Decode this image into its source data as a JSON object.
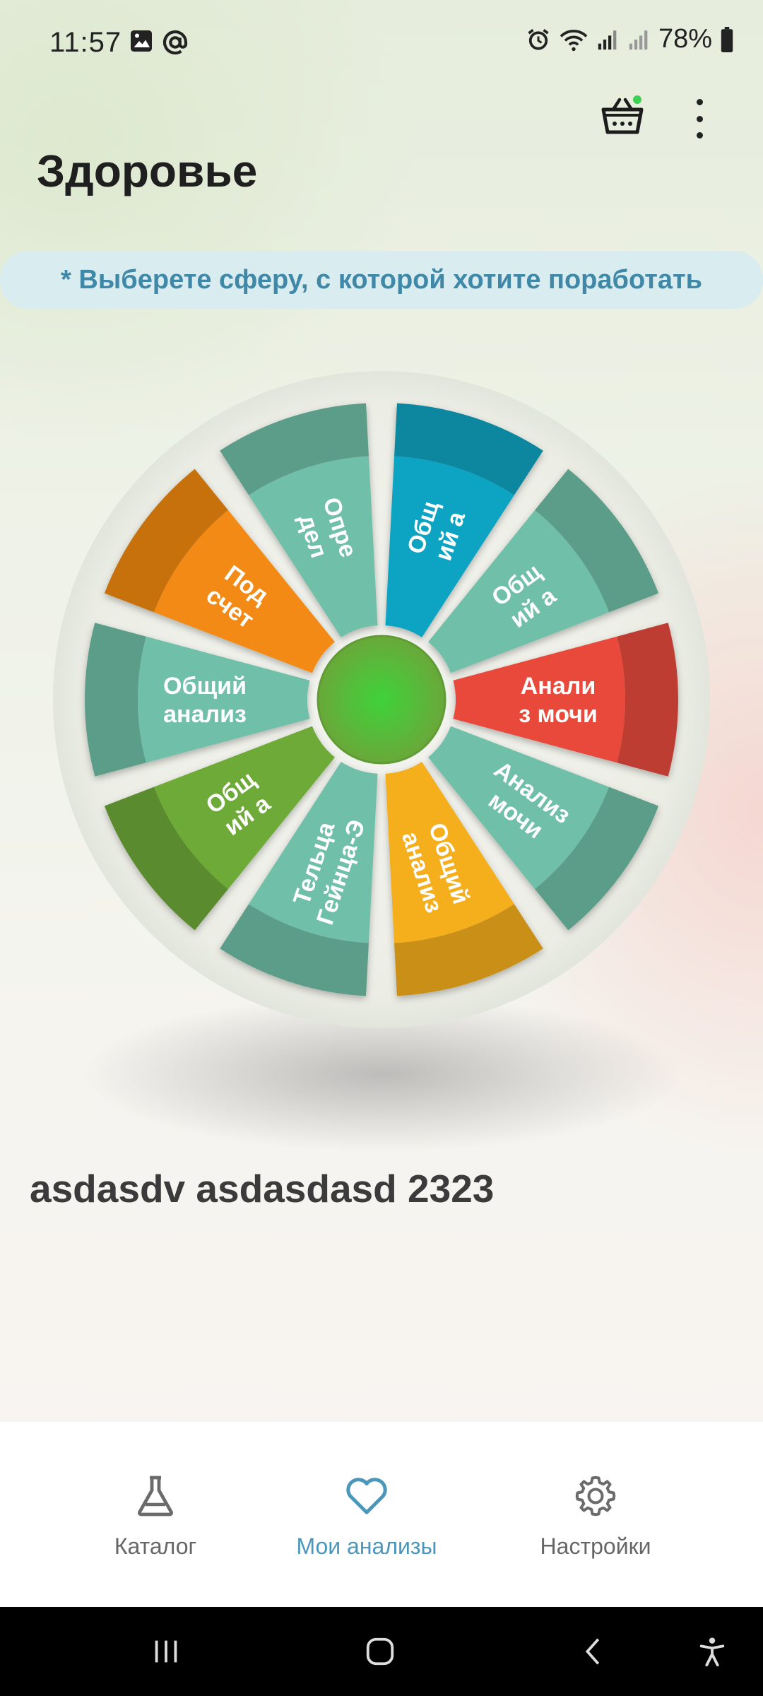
{
  "status_bar": {
    "time": "11:57",
    "battery": "78%",
    "left_icons": [
      "image-icon",
      "at-icon"
    ],
    "right_icons": [
      "alarm-icon",
      "wifi-icon",
      "signal-icon",
      "signal-icon",
      "battery-icon"
    ]
  },
  "header": {
    "title": "Здоровье",
    "cart_icon": "basket-icon",
    "more_icon": "more-vertical-icon"
  },
  "hint": "* Выберете сферу, с которой хотите поработать",
  "wheel": {
    "segments": [
      {
        "label_lines": [
          "Опре",
          "дел"
        ],
        "color": "#6fbfa8"
      },
      {
        "label_lines": [
          "Общ",
          "ий а"
        ],
        "color": "#0aa3c2"
      },
      {
        "label_lines": [
          "Общ",
          "ий а"
        ],
        "color": "#6fbfa8"
      },
      {
        "label_lines": [
          "Анали",
          "з мочи"
        ],
        "color": "#e8493a"
      },
      {
        "label_lines": [
          "Анализ",
          "мочи"
        ],
        "color": "#6fbfa8"
      },
      {
        "label_lines": [
          "Общий",
          "анализ"
        ],
        "color": "#f5ae1d"
      },
      {
        "label_lines": [
          "Тельца",
          "Гейнца-Э"
        ],
        "color": "#6fbfa8"
      },
      {
        "label_lines": [
          "Общ",
          "ий а"
        ],
        "color": "#6eaa37"
      },
      {
        "label_lines": [
          "Общий",
          "анализ"
        ],
        "color": "#6fbfa8"
      },
      {
        "label_lines": [
          "Под",
          "счет"
        ],
        "color": "#f38a12"
      }
    ],
    "center_color": "#4fba3a"
  },
  "profile": {
    "name": "asdasdv asdasdasd 2323"
  },
  "bottom_nav": [
    {
      "label": "Каталог",
      "icon": "flask-icon",
      "active": false
    },
    {
      "label": "Мои анализы",
      "icon": "heart-icon",
      "active": true
    },
    {
      "label": "Настройки",
      "icon": "gear-icon",
      "active": false
    }
  ],
  "system_nav": [
    "recents-icon",
    "home-icon",
    "back-icon",
    "accessibility-icon"
  ]
}
